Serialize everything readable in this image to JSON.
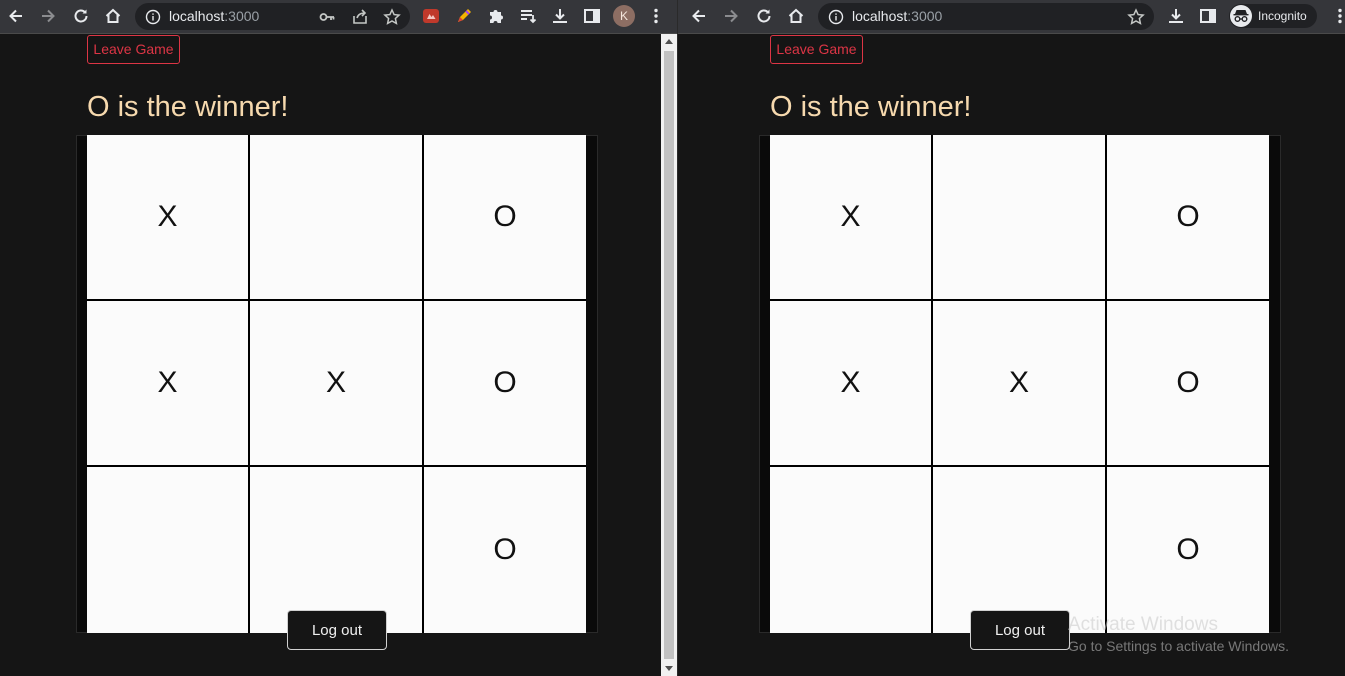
{
  "left_window": {
    "address": {
      "host": "localhost",
      "port": ":3000"
    },
    "profile_initial": "K",
    "game": {
      "leave_label": "Leave Game",
      "status_text": "O is the winner!",
      "board": [
        [
          "X",
          "",
          "O"
        ],
        [
          "X",
          "X",
          "O"
        ],
        [
          "",
          "",
          "O"
        ]
      ],
      "logout_label": "Log out"
    }
  },
  "right_window": {
    "address": {
      "host": "localhost",
      "port": ":3000"
    },
    "incognito_label": "Incognito",
    "game": {
      "leave_label": "Leave Game",
      "status_text": "O is the winner!",
      "board": [
        [
          "X",
          "",
          "O"
        ],
        [
          "X",
          "X",
          "O"
        ],
        [
          "",
          "",
          "O"
        ]
      ],
      "logout_label": "Log out"
    }
  },
  "windows_watermark": {
    "title": "Activate Windows",
    "subtitle": "Go to Settings to activate Windows."
  },
  "colors": {
    "page_background": "#151515",
    "status_text": "#f6d9ae",
    "leave_button": "#dc3545",
    "board_cell": "#fbfbfb",
    "toolbar": "#35363a"
  },
  "icons": {
    "nav": [
      "back-icon",
      "forward-icon",
      "reload-icon",
      "home-icon"
    ],
    "omnibox": [
      "info-icon",
      "key-icon",
      "share-icon",
      "bookmark-star-icon"
    ],
    "extensions": [
      "extension-red-icon",
      "extension-pen-icon",
      "puzzle-extensions-icon",
      "reading-list-icon",
      "download-icon",
      "side-panel-icon",
      "menu-kebab-icon"
    ]
  }
}
